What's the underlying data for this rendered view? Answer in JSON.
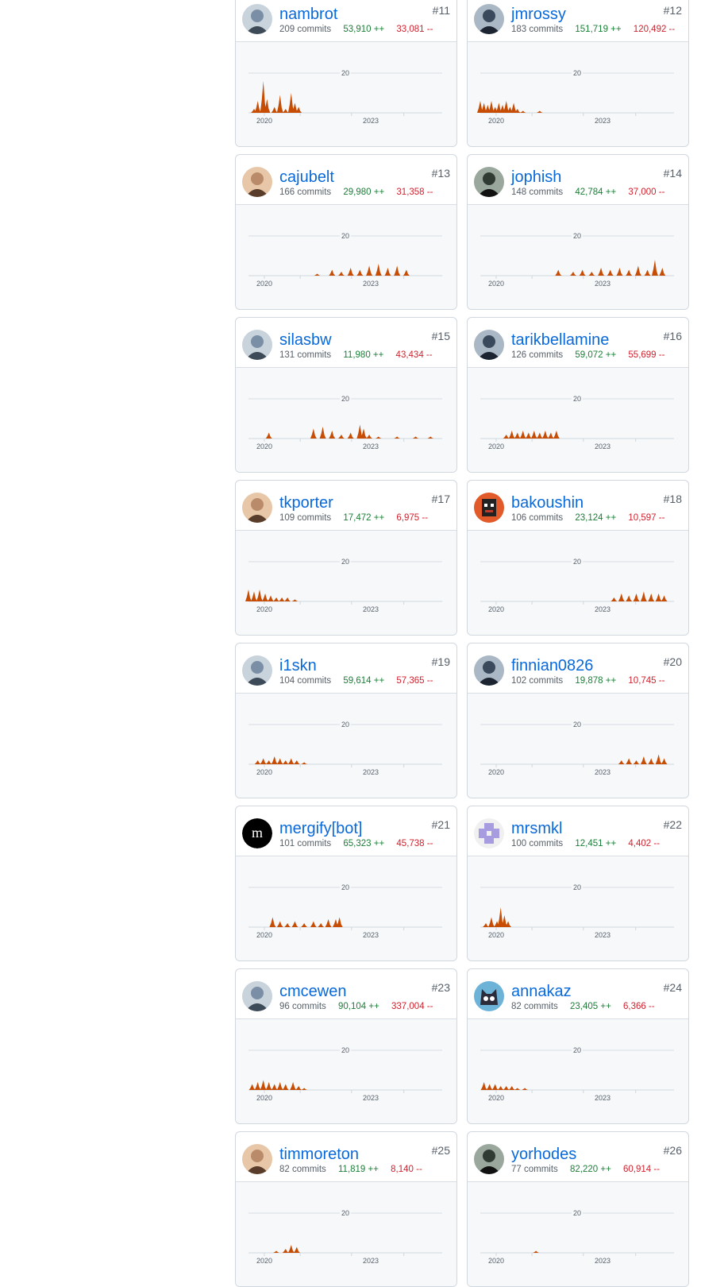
{
  "chart_defaults": {
    "x_ticks": [
      "2020",
      "2023"
    ],
    "y_tick": "20",
    "fill_color": "#c64d03"
  },
  "contributors": [
    {
      "rank": "#11",
      "login": "nambrot",
      "commits": "209 commits",
      "additions": "53,910 ++",
      "deletions": "33,081 --",
      "avatar": "photo",
      "activity": [
        [
          0.03,
          0.1
        ],
        [
          0.05,
          0.3
        ],
        [
          0.08,
          0.8
        ],
        [
          0.1,
          0.35
        ],
        [
          0.14,
          0.15
        ],
        [
          0.17,
          0.45
        ],
        [
          0.2,
          0.1
        ],
        [
          0.23,
          0.5
        ],
        [
          0.25,
          0.25
        ],
        [
          0.27,
          0.15
        ]
      ]
    },
    {
      "rank": "#12",
      "login": "jmrossy",
      "commits": "183 commits",
      "additions": "151,719 ++",
      "deletions": "120,492 --",
      "avatar": "photo",
      "activity": [
        [
          0.0,
          0.3
        ],
        [
          0.02,
          0.25
        ],
        [
          0.04,
          0.2
        ],
        [
          0.06,
          0.3
        ],
        [
          0.08,
          0.15
        ],
        [
          0.1,
          0.25
        ],
        [
          0.12,
          0.2
        ],
        [
          0.14,
          0.3
        ],
        [
          0.16,
          0.15
        ],
        [
          0.18,
          0.25
        ],
        [
          0.2,
          0.1
        ],
        [
          0.23,
          0.05
        ],
        [
          0.32,
          0.05
        ]
      ]
    },
    {
      "rank": "#13",
      "login": "cajubelt",
      "commits": "166 commits",
      "additions": "29,980 ++",
      "deletions": "31,358 --",
      "avatar": "photo",
      "activity": [
        [
          0.37,
          0.05
        ],
        [
          0.45,
          0.15
        ],
        [
          0.5,
          0.1
        ],
        [
          0.55,
          0.2
        ],
        [
          0.6,
          0.15
        ],
        [
          0.65,
          0.25
        ],
        [
          0.7,
          0.3
        ],
        [
          0.75,
          0.2
        ],
        [
          0.8,
          0.25
        ],
        [
          0.85,
          0.15
        ]
      ]
    },
    {
      "rank": "#14",
      "login": "jophish",
      "commits": "148 commits",
      "additions": "42,784 ++",
      "deletions": "37,000 --",
      "avatar": "photo",
      "activity": [
        [
          0.42,
          0.15
        ],
        [
          0.5,
          0.1
        ],
        [
          0.55,
          0.15
        ],
        [
          0.6,
          0.1
        ],
        [
          0.65,
          0.2
        ],
        [
          0.7,
          0.15
        ],
        [
          0.75,
          0.2
        ],
        [
          0.8,
          0.15
        ],
        [
          0.85,
          0.25
        ],
        [
          0.9,
          0.15
        ],
        [
          0.94,
          0.4
        ],
        [
          0.98,
          0.2
        ]
      ]
    },
    {
      "rank": "#15",
      "login": "silasbw",
      "commits": "131 commits",
      "additions": "11,980 ++",
      "deletions": "43,434 --",
      "avatar": "photo",
      "activity": [
        [
          0.11,
          0.15
        ],
        [
          0.35,
          0.25
        ],
        [
          0.4,
          0.3
        ],
        [
          0.45,
          0.2
        ],
        [
          0.5,
          0.1
        ],
        [
          0.55,
          0.15
        ],
        [
          0.6,
          0.35
        ],
        [
          0.62,
          0.25
        ],
        [
          0.65,
          0.1
        ],
        [
          0.7,
          0.05
        ],
        [
          0.8,
          0.05
        ],
        [
          0.9,
          0.05
        ],
        [
          0.98,
          0.05
        ]
      ]
    },
    {
      "rank": "#16",
      "login": "tarikbellamine",
      "commits": "126 commits",
      "additions": "59,072 ++",
      "deletions": "55,699 --",
      "avatar": "photo",
      "activity": [
        [
          0.14,
          0.1
        ],
        [
          0.17,
          0.2
        ],
        [
          0.2,
          0.15
        ],
        [
          0.23,
          0.2
        ],
        [
          0.26,
          0.15
        ],
        [
          0.29,
          0.2
        ],
        [
          0.32,
          0.15
        ],
        [
          0.35,
          0.2
        ],
        [
          0.38,
          0.15
        ],
        [
          0.41,
          0.2
        ]
      ]
    },
    {
      "rank": "#17",
      "login": "tkporter",
      "commits": "109 commits",
      "additions": "17,472 ++",
      "deletions": "6,975 --",
      "avatar": "photo",
      "activity": [
        [
          0.0,
          0.3
        ],
        [
          0.03,
          0.25
        ],
        [
          0.06,
          0.3
        ],
        [
          0.09,
          0.2
        ],
        [
          0.12,
          0.15
        ],
        [
          0.15,
          0.1
        ],
        [
          0.18,
          0.1
        ],
        [
          0.21,
          0.1
        ],
        [
          0.25,
          0.05
        ]
      ]
    },
    {
      "rank": "#18",
      "login": "bakoushin",
      "commits": "106 commits",
      "additions": "23,124 ++",
      "deletions": "10,597 --",
      "avatar": "pixel",
      "activity": [
        [
          0.72,
          0.1
        ],
        [
          0.76,
          0.2
        ],
        [
          0.8,
          0.15
        ],
        [
          0.84,
          0.2
        ],
        [
          0.88,
          0.25
        ],
        [
          0.92,
          0.2
        ],
        [
          0.96,
          0.2
        ],
        [
          0.99,
          0.15
        ]
      ]
    },
    {
      "rank": "#19",
      "login": "i1skn",
      "commits": "104 commits",
      "additions": "59,614 ++",
      "deletions": "57,365 --",
      "avatar": "photo",
      "activity": [
        [
          0.05,
          0.1
        ],
        [
          0.08,
          0.15
        ],
        [
          0.11,
          0.1
        ],
        [
          0.14,
          0.2
        ],
        [
          0.17,
          0.15
        ],
        [
          0.2,
          0.1
        ],
        [
          0.23,
          0.15
        ],
        [
          0.26,
          0.1
        ],
        [
          0.3,
          0.05
        ]
      ]
    },
    {
      "rank": "#20",
      "login": "finnian0826",
      "commits": "102 commits",
      "additions": "19,878 ++",
      "deletions": "10,745 --",
      "avatar": "photo",
      "activity": [
        [
          0.76,
          0.1
        ],
        [
          0.8,
          0.15
        ],
        [
          0.84,
          0.1
        ],
        [
          0.88,
          0.2
        ],
        [
          0.92,
          0.15
        ],
        [
          0.96,
          0.25
        ],
        [
          0.99,
          0.15
        ]
      ]
    },
    {
      "rank": "#21",
      "login": "mergify[bot]",
      "commits": "101 commits",
      "additions": "65,323 ++",
      "deletions": "45,738 --",
      "avatar": "mergify",
      "activity": [
        [
          0.13,
          0.25
        ],
        [
          0.17,
          0.15
        ],
        [
          0.21,
          0.1
        ],
        [
          0.25,
          0.15
        ],
        [
          0.3,
          0.1
        ],
        [
          0.35,
          0.15
        ],
        [
          0.39,
          0.1
        ],
        [
          0.43,
          0.2
        ],
        [
          0.47,
          0.2
        ],
        [
          0.49,
          0.25
        ]
      ]
    },
    {
      "rank": "#22",
      "login": "mrsmkl",
      "commits": "100 commits",
      "additions": "12,451 ++",
      "deletions": "4,402 --",
      "avatar": "identicon",
      "activity": [
        [
          0.03,
          0.1
        ],
        [
          0.06,
          0.25
        ],
        [
          0.09,
          0.15
        ],
        [
          0.11,
          0.5
        ],
        [
          0.13,
          0.3
        ],
        [
          0.15,
          0.15
        ]
      ]
    },
    {
      "rank": "#23",
      "login": "cmcewen",
      "commits": "96 commits",
      "additions": "90,104 ++",
      "deletions": "337,004 --",
      "avatar": "photo",
      "activity": [
        [
          0.02,
          0.15
        ],
        [
          0.05,
          0.2
        ],
        [
          0.08,
          0.25
        ],
        [
          0.11,
          0.2
        ],
        [
          0.14,
          0.15
        ],
        [
          0.17,
          0.2
        ],
        [
          0.2,
          0.15
        ],
        [
          0.24,
          0.2
        ],
        [
          0.27,
          0.1
        ],
        [
          0.3,
          0.05
        ]
      ]
    },
    {
      "rank": "#24",
      "login": "annakaz",
      "commits": "82 commits",
      "additions": "23,405 ++",
      "deletions": "6,366 --",
      "avatar": "cat",
      "activity": [
        [
          0.02,
          0.2
        ],
        [
          0.05,
          0.15
        ],
        [
          0.08,
          0.15
        ],
        [
          0.11,
          0.1
        ],
        [
          0.14,
          0.1
        ],
        [
          0.17,
          0.1
        ],
        [
          0.2,
          0.05
        ],
        [
          0.24,
          0.05
        ]
      ]
    },
    {
      "rank": "#25",
      "login": "timmoreton",
      "commits": "82 commits",
      "additions": "11,819 ++",
      "deletions": "8,140 --",
      "avatar": "photo",
      "activity": [
        [
          0.15,
          0.05
        ],
        [
          0.2,
          0.1
        ],
        [
          0.23,
          0.2
        ],
        [
          0.26,
          0.15
        ]
      ]
    },
    {
      "rank": "#26",
      "login": "yorhodes",
      "commits": "77 commits",
      "additions": "82,220 ++",
      "deletions": "60,914 --",
      "avatar": "photo",
      "activity": [
        [
          0.3,
          0.05
        ]
      ]
    }
  ]
}
